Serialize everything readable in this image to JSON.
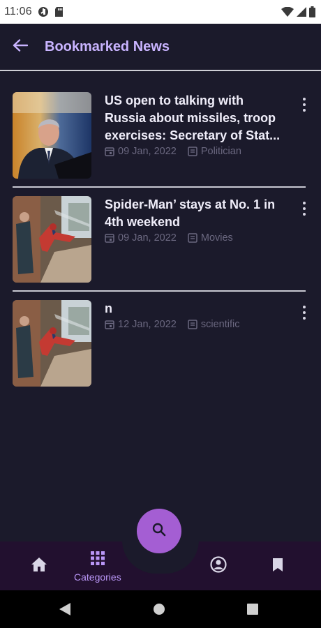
{
  "status_bar": {
    "time": "11:06"
  },
  "app_bar": {
    "title": "Bookmarked News"
  },
  "news": [
    {
      "title": "US open to talking with Russia about missiles, troop exercises: Secretary of Stat...",
      "date": "09 Jan, 2022",
      "category": "Politician"
    },
    {
      "title": "Spider-Man’ stays at No. 1 in 4th weekend",
      "date": "09 Jan, 2022",
      "category": "Movies"
    },
    {
      "title": "n",
      "date": "12 Jan, 2022",
      "category": "scientific"
    }
  ],
  "bottom_nav": {
    "categories_label": "Categories"
  },
  "colors": {
    "accent": "#c9b4ff",
    "fab": "#a45ed3",
    "background": "#1b1a2b",
    "nav_background": "#22102f"
  }
}
